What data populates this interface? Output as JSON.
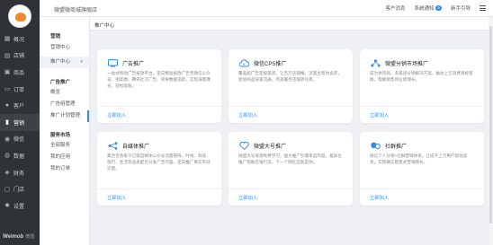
{
  "topbar": {
    "shop_name": "微盟微商城旗舰店",
    "links": {
      "customer_msg": "客户消息",
      "system_notice": "系统通知",
      "notice_count": "5",
      "guide": "新手引导"
    }
  },
  "rail": {
    "items": [
      "概况",
      "店铺",
      "商品",
      "订单",
      "客户",
      "营销",
      "微信",
      "数据",
      "财务",
      "门店",
      "设置"
    ],
    "brand": "Weimob",
    "brand_sub": "微盟"
  },
  "subnav": {
    "sec1": "营销",
    "marketing_center": "营销中心",
    "promo_center": "推广中心",
    "sec2": "广告推广",
    "overview": "概览",
    "ad_manage": "广告组管理",
    "ad_plan": "推广计划管理",
    "sec3": "服务市场",
    "all_services": "全部服务",
    "my_apps": "我的应用",
    "my_orders": "我的订单"
  },
  "page": {
    "title": "推广中心"
  },
  "cards": [
    {
      "title": "广告推广",
      "desc": "一站式移动广告投放平台，定向精准投放广告至微信公众号、朋友圈、腾讯社交广告、效果数据追踪，实现海量曝光，轻松吸粉。",
      "action": "立即加入"
    },
    {
      "title": "微信CPS推广",
      "desc": "覆盖超广告定投渠道，让百万店铺推、流量主帮你卖货，促进商品快速流通，完美服务店铺转化率。",
      "action": "立即加入"
    },
    {
      "title": "微盟分销市场推广",
      "desc": "成为供货商，多渠道分销解决方案，触达上亿消费目标客群，帮助销售和业绩增长。",
      "action": "立即加入"
    },
    {
      "title": "自媒体推广",
      "desc": "集合百余家千亿级自媒体公众号流量矩阵，时尚、科技、旅行、生活等品类配合分发广告内容，定向推广真实有效流量。",
      "action": "立即加入"
    },
    {
      "title": "微盟大号推广",
      "desc": "微盟大号资源免费学习，图文推广引爆单品热度，差异位推广帮助店铺引流，下一个网红店就是你。",
      "action": "立即加入"
    },
    {
      "title": "社群推广",
      "desc": "微信个人分销+社群营销体系，让成千上万用户帮他卖货，实现微信裂变式营销增长。",
      "action": "立即加入"
    }
  ],
  "colors": {
    "accent": "#2d8cf0",
    "rail_bg": "#2f3338",
    "logo": "#f08a2c"
  }
}
